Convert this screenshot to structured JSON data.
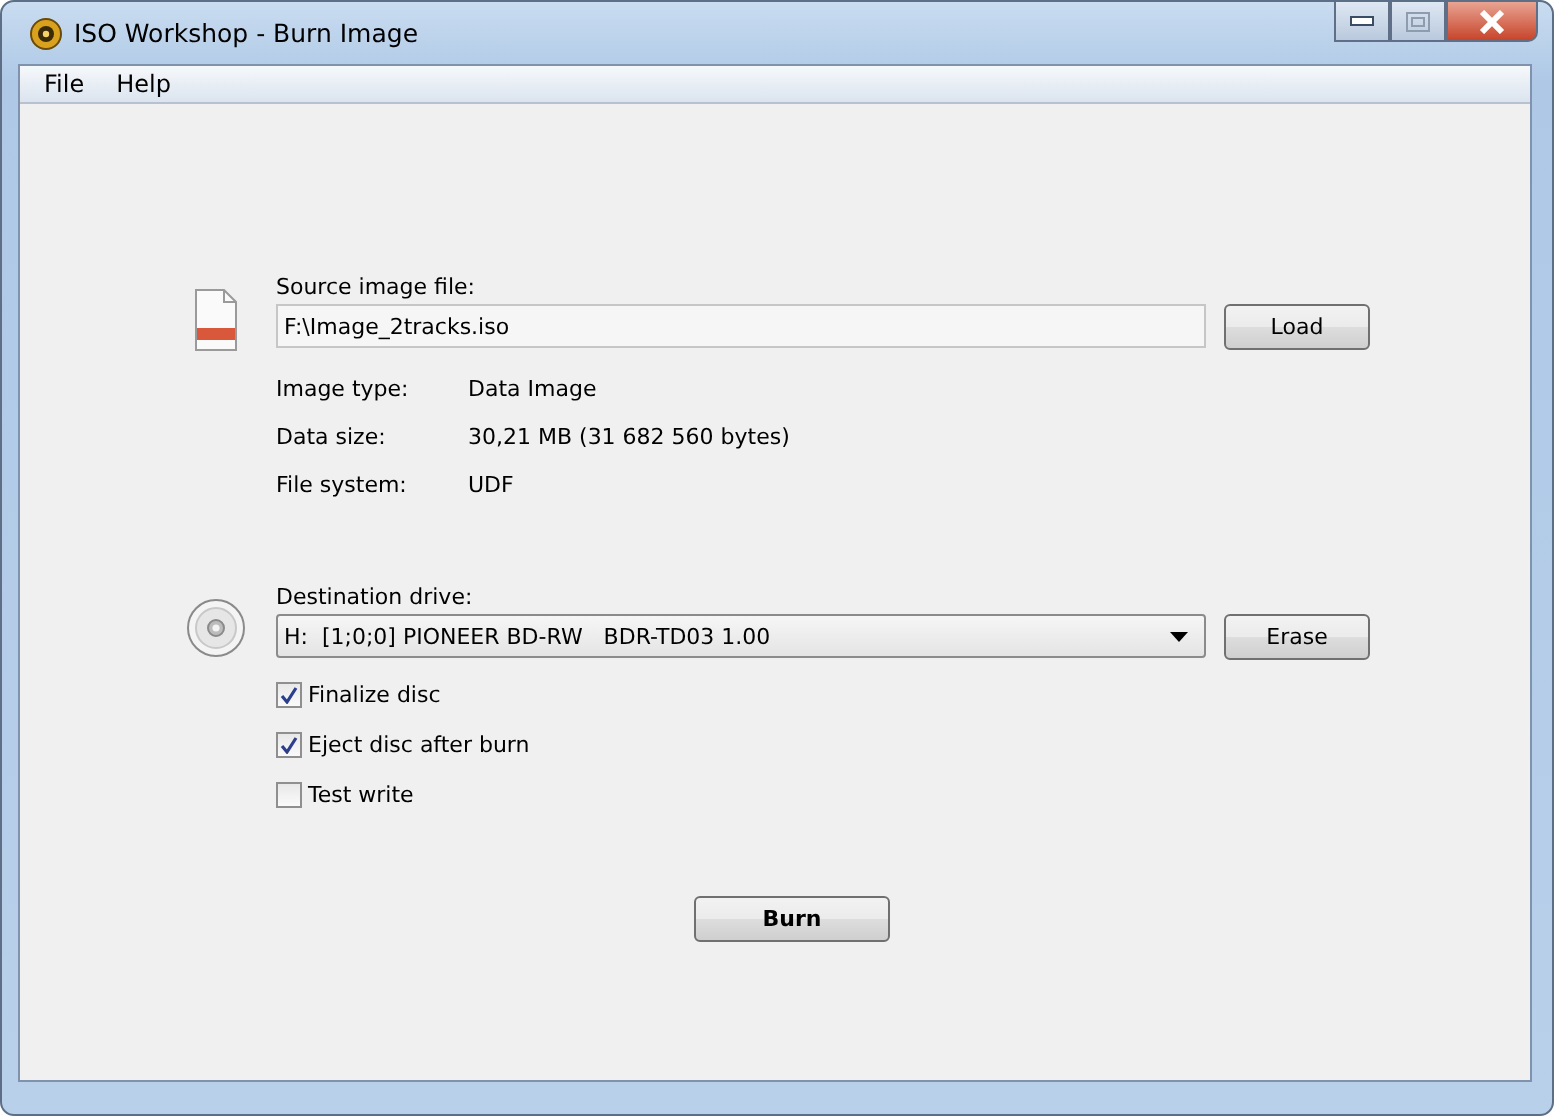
{
  "window": {
    "title": "ISO Workshop - Burn Image"
  },
  "menu": [
    "File",
    "Help"
  ],
  "source": {
    "label": "Source image file:",
    "value": "F:\\Image_2tracks.iso",
    "button": "Load"
  },
  "info": [
    {
      "label": "Image type:",
      "value": "Data Image"
    },
    {
      "label": "Data size:",
      "value": "30,21 MB (31 682 560 bytes)"
    },
    {
      "label": "File system:",
      "value": "UDF"
    }
  ],
  "destination": {
    "label": "Destination drive:",
    "value": "H:  [1;0;0] PIONEER BD-RW   BDR-TD03 1.00",
    "button": "Erase"
  },
  "options": [
    {
      "label": "Finalize disc",
      "checked": true
    },
    {
      "label": "Eject disc after burn",
      "checked": true
    },
    {
      "label": "Test write",
      "checked": false
    }
  ],
  "burn_button": "Burn"
}
